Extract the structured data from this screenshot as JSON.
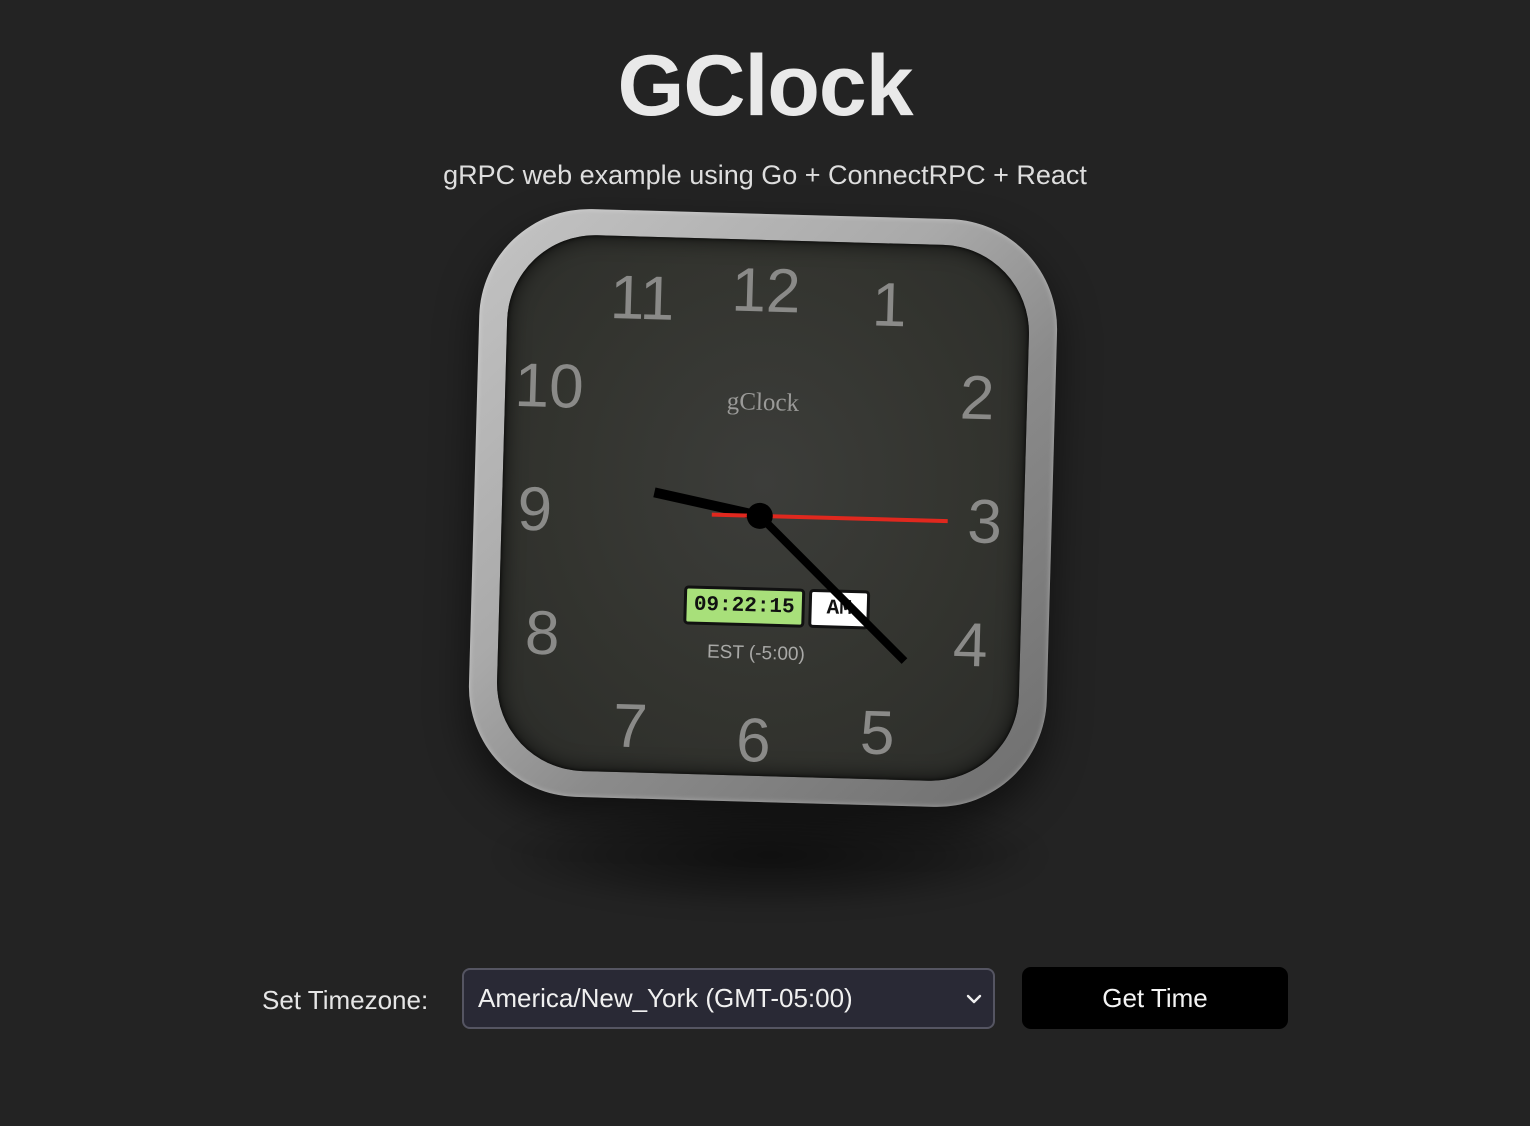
{
  "header": {
    "title": "GClock",
    "subtitle": "gRPC web example using Go + ConnectRPC + React"
  },
  "clock": {
    "brand": "gClock",
    "numbers": [
      "12",
      "1",
      "2",
      "3",
      "4",
      "5",
      "6",
      "7",
      "8",
      "9",
      "10",
      "11"
    ],
    "digital_time": "09:22:15",
    "meridiem": "AM",
    "timezone_label": "EST (-5:00)",
    "time": {
      "hours": 9,
      "minutes": 22,
      "seconds": 15
    },
    "colors": {
      "digital_bg": "#a8e07a",
      "second_hand": "#e0281e",
      "hands": "#000000"
    }
  },
  "controls": {
    "label": "Set Timezone:",
    "timezone_value": "America/New_York (GMT-05:00)",
    "button_label": "Get Time"
  }
}
